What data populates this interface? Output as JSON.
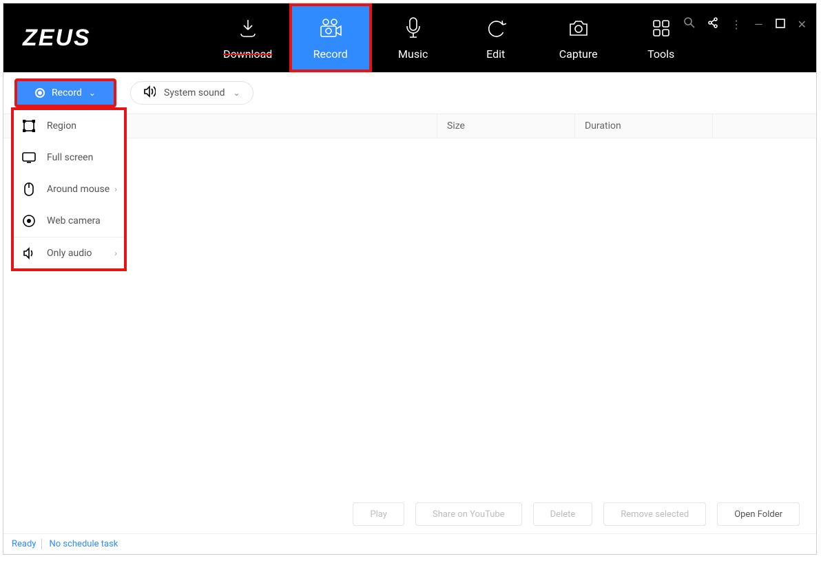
{
  "app": {
    "logo": "ZEUS"
  },
  "tabs": [
    {
      "label": "Download"
    },
    {
      "label": "Record"
    },
    {
      "label": "Music"
    },
    {
      "label": "Edit"
    },
    {
      "label": "Capture"
    },
    {
      "label": "Tools"
    }
  ],
  "toolbar": {
    "record_label": "Record",
    "sound_label": "System sound"
  },
  "dropdown": {
    "region": "Region",
    "full_screen": "Full screen",
    "around_mouse": "Around mouse",
    "web_camera": "Web camera",
    "only_audio": "Only audio"
  },
  "columns": {
    "size": "Size",
    "duration": "Duration"
  },
  "footer": {
    "play": "Play",
    "share": "Share on YouTube",
    "delete": "Delete",
    "remove": "Remove selected",
    "open": "Open Folder"
  },
  "status": {
    "ready": "Ready",
    "schedule": "No schedule task"
  }
}
